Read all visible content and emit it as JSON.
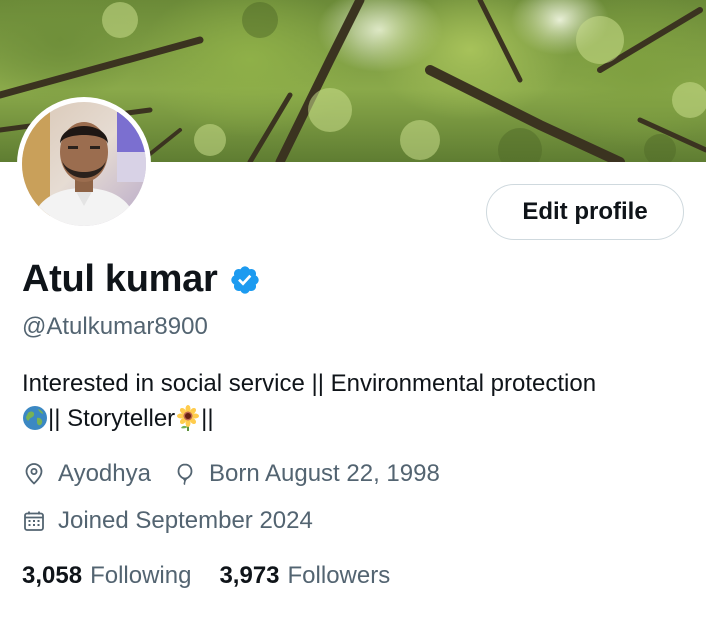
{
  "profile": {
    "name": "Atul kumar",
    "handle": "@Atulkumar8900",
    "edit_label": "Edit profile",
    "bio_line1": "Interested in social service || Environmental protection",
    "bio_line2_a": "|| Storyteller",
    "bio_line2_b": "||",
    "location": "Ayodhya",
    "birthday": "Born August 22, 1998",
    "joined": "Joined September 2024",
    "following_count": "3,058",
    "following_label": "Following",
    "followers_count": "3,973",
    "followers_label": "Followers"
  },
  "icons": {
    "verified": "verified-badge-icon",
    "location": "location-pin-icon",
    "birthday": "balloon-icon",
    "joined": "calendar-icon",
    "globe": "globe-emoji",
    "sunflower": "sunflower-emoji"
  },
  "colors": {
    "verified_blue": "#1d9bf0",
    "secondary_text": "#536471",
    "primary_text": "#0f1419",
    "button_border": "#cfd9de"
  }
}
